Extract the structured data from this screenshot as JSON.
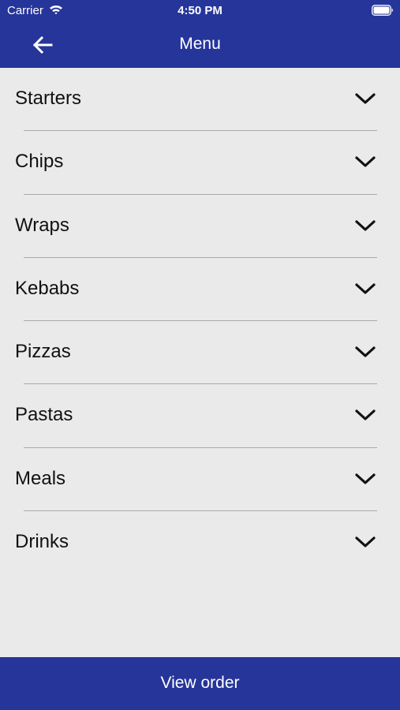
{
  "status_bar": {
    "carrier": "Carrier",
    "time": "4:50 PM"
  },
  "nav": {
    "title": "Menu",
    "back_icon": "arrow-left-icon"
  },
  "menu": {
    "items": [
      {
        "label": "Starters",
        "icon": "chevron-down-icon"
      },
      {
        "label": "Chips",
        "icon": "chevron-down-icon"
      },
      {
        "label": "Wraps",
        "icon": "chevron-down-icon"
      },
      {
        "label": "Kebabs",
        "icon": "chevron-down-icon"
      },
      {
        "label": "Pizzas",
        "icon": "chevron-down-icon"
      },
      {
        "label": "Pastas",
        "icon": "chevron-down-icon"
      },
      {
        "label": "Meals",
        "icon": "chevron-down-icon"
      },
      {
        "label": "Drinks",
        "icon": "chevron-down-icon"
      }
    ]
  },
  "footer": {
    "view_order_label": "View order"
  },
  "colors": {
    "brand": "#26359a",
    "background": "#eaeaea",
    "divider": "#a9a9a9",
    "text": "#111111"
  }
}
